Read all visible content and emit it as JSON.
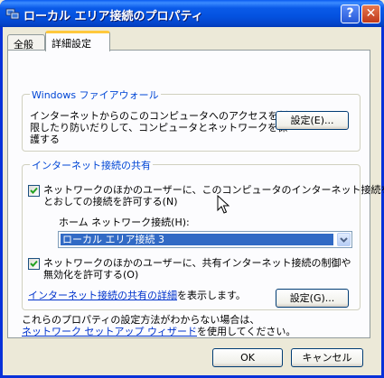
{
  "window": {
    "title": "ローカル エリア接続のプロパティ",
    "help_label": "?",
    "close_label": "✕"
  },
  "tabs": [
    {
      "label": "全般"
    },
    {
      "label": "詳細設定"
    }
  ],
  "firewall": {
    "title": "Windows ファイアウォール",
    "desc_line1": "インターネットからのこのコンピュータへのアクセスを制",
    "desc_line2": "限したり防いだりして、コンピュータとネットワークを保",
    "desc_line3": "護する",
    "settings_button": "設定(E)..."
  },
  "ics": {
    "title": "インターネット接続の共有",
    "allow_share_line1": "ネットワークのほかのユーザーに、このコンピュータのインターネット接続を",
    "allow_share_line2": "とおしての接続を許可する(N)",
    "allow_share_checked": true,
    "home_network_label": "ホーム ネットワーク接続(H):",
    "home_network_value": "ローカル エリア接続 3",
    "allow_control_line1": "ネットワークのほかのユーザーに、共有インターネット接続の制御や",
    "allow_control_line2": "無効化を許可する(O)",
    "allow_control_checked": true,
    "details_link": "インターネット接続の共有の詳細",
    "details_suffix": "を表示します。",
    "settings_button": "設定(G)..."
  },
  "footer": {
    "help_line1": "これらのプロパティの設定方法がわからない場合は、",
    "wizard_link": "ネットワーク セットアップ ウィザード",
    "help_line2_suffix": "を使用してください。"
  },
  "buttons": {
    "ok": "OK",
    "cancel": "キャンセル"
  },
  "colors": {
    "titlebar": "#0a5ae8",
    "group_title": "#0046d5",
    "link": "#0033cc",
    "selection": "#316ac5"
  },
  "icons": {
    "title": "network-connection-icon",
    "help": "question-mark-icon",
    "close": "close-x-icon",
    "dropdown": "chevron-down-icon",
    "check": "checkmark-icon",
    "cursor": "mouse-pointer-icon"
  }
}
